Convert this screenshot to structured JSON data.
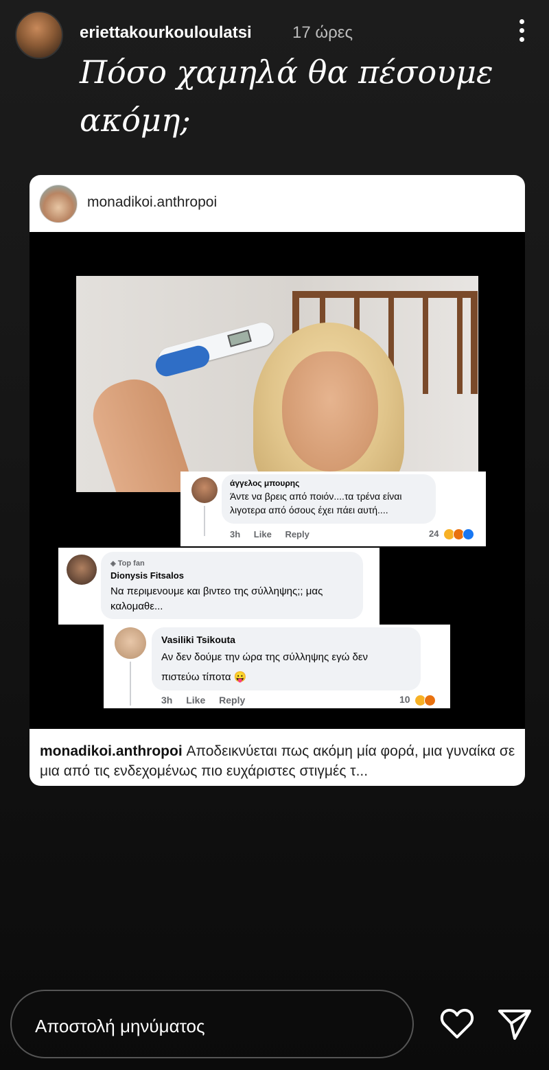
{
  "header": {
    "username": "eriettakourkouloulatsi",
    "timestamp": "17 ώρες"
  },
  "story_caption": "Πόσο χαμηλά θα πέσουμε ακόμη;",
  "repost": {
    "username": "monadikoi.anthropoi",
    "footer_username": "monadikoi.anthropoi",
    "footer_text": "Αποδεικνύεται πως ακόμη μία φορά, μια γυναίκα  σε μια από τις ενδεχομένως πιο ευχάριστες στιγμές τ..."
  },
  "comments": [
    {
      "name": "άγγελος μπουρης",
      "text": "Άντε να βρεις από ποιόν....τα τρένα είναι λιγοτερα από όσους έχει πάει αυτή....",
      "time": "3h",
      "like": "Like",
      "reply": "Reply",
      "reactions": "24"
    },
    {
      "badge": "Top fan",
      "name": "Dionysis Fitsalos",
      "text": "Να περιμενουμε και βιντεο της σύλληψης;; μας καλομαθε..."
    },
    {
      "name": "Vasiliki Tsikouta",
      "text": "Αν δεν δούμε την ώρα της σύλληψης εγώ δεν πιστεύω τίποτα 😛",
      "time": "3h",
      "like": "Like",
      "reply": "Reply",
      "reactions": "10"
    }
  ],
  "bottom_bar": {
    "placeholder": "Αποστολή μηνύματος"
  },
  "icons": {
    "more": "more-vertical-icon",
    "heart": "heart-icon",
    "send": "send-icon"
  }
}
